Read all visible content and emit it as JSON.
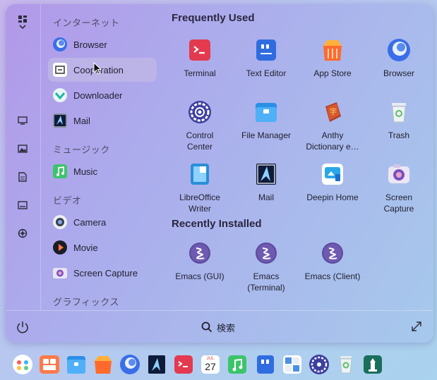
{
  "rail": {
    "icons": [
      "grid-icon",
      "monitor-icon",
      "image-icon",
      "document-icon",
      "screen-icon",
      "settings-wheel-icon"
    ]
  },
  "categories": {
    "internet_header": "インターネット",
    "music_header": "ミュージック",
    "video_header": "ビデオ",
    "graphics_header": "グラフィックス",
    "items": [
      "Browser",
      "Cooperation",
      "Downloader",
      "Mail",
      "Music",
      "Camera",
      "Movie",
      "Screen Capture"
    ]
  },
  "frequently_used": {
    "title": "Frequently Used",
    "apps": [
      {
        "l1": "Terminal",
        "l2": ""
      },
      {
        "l1": "Text Editor",
        "l2": ""
      },
      {
        "l1": "App Store",
        "l2": ""
      },
      {
        "l1": "Browser",
        "l2": ""
      },
      {
        "l1": "Control",
        "l2": "Center"
      },
      {
        "l1": "File Manager",
        "l2": ""
      },
      {
        "l1": "Anthy",
        "l2": "Dictionary e…"
      },
      {
        "l1": "Trash",
        "l2": ""
      },
      {
        "l1": "LibreOffice",
        "l2": "Writer"
      },
      {
        "l1": "Mail",
        "l2": ""
      },
      {
        "l1": "Deepin Home",
        "l2": ""
      },
      {
        "l1": "Screen",
        "l2": "Capture"
      }
    ]
  },
  "recently_installed": {
    "title": "Recently Installed",
    "apps": [
      {
        "l1": "Emacs (GUI)",
        "l2": ""
      },
      {
        "l1": "Emacs",
        "l2": "(Terminal)"
      },
      {
        "l1": "Emacs (Client)",
        "l2": ""
      }
    ]
  },
  "footer": {
    "search_label": "検索"
  },
  "dock": {
    "calendar_month": "JUL",
    "calendar_day": "27"
  }
}
